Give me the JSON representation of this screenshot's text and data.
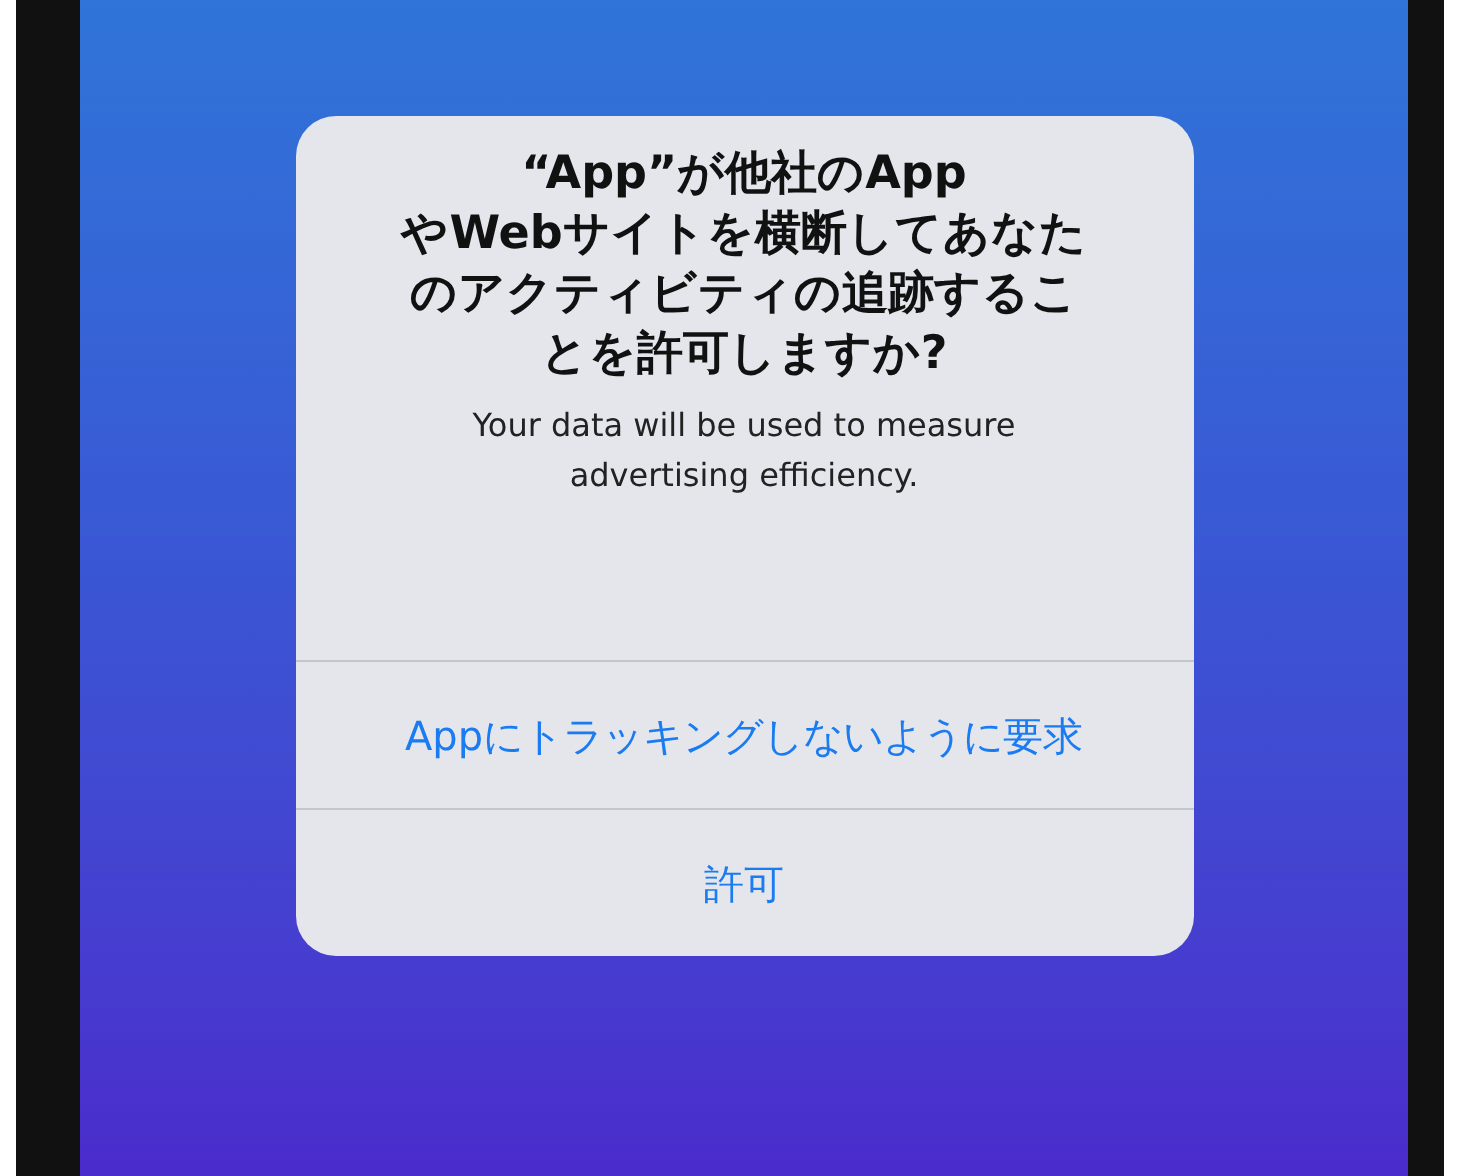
{
  "dialog": {
    "title_lines": [
      "“App”が他社のApp",
      "やWebサイトを横断してあなた",
      "のアクティビティの追跡するこ",
      "とを許可しますか?"
    ],
    "message": "Your data will be used to measure advertising efficiency.",
    "buttons": [
      "Appにトラッキングしないように要求",
      "許可"
    ]
  }
}
